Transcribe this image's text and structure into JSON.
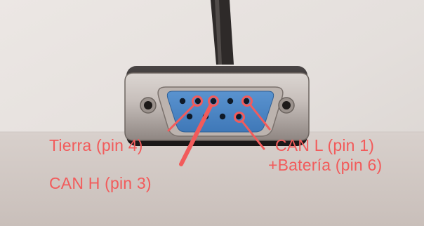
{
  "photo": {
    "subject": "db9-female-connector-pinout",
    "annotation_color": "#f25b5b",
    "labels": {
      "tierra": "Tierra (pin 4)",
      "can_h": "CAN H (pin 3)",
      "can_l": "CAN L (pin 1)",
      "bateria": "+Batería (pin 6)"
    }
  }
}
